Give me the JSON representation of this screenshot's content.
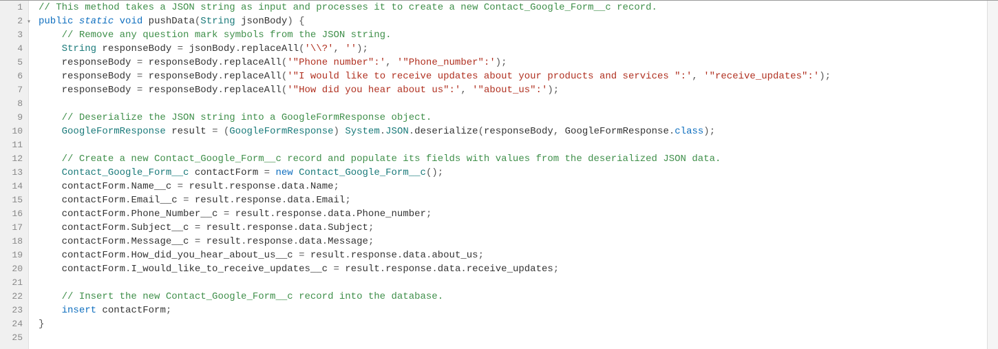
{
  "code": {
    "lines": [
      {
        "n": "1",
        "fold": false,
        "tokens": [
          {
            "c": "tok-comment",
            "t": "// This method takes a JSON string as input and processes it to create a new Contact_Google_Form__c record."
          }
        ]
      },
      {
        "n": "2",
        "fold": true,
        "tokens": [
          {
            "c": "tok-keyword",
            "t": "public"
          },
          {
            "c": "",
            "t": " "
          },
          {
            "c": "tok-static",
            "t": "static"
          },
          {
            "c": "",
            "t": " "
          },
          {
            "c": "tok-keyword",
            "t": "void"
          },
          {
            "c": "",
            "t": " "
          },
          {
            "c": "tok-method",
            "t": "pushData"
          },
          {
            "c": "tok-punc",
            "t": "("
          },
          {
            "c": "tok-type",
            "t": "String"
          },
          {
            "c": "",
            "t": " jsonBody"
          },
          {
            "c": "tok-punc",
            "t": ")"
          },
          {
            "c": "",
            "t": " "
          },
          {
            "c": "tok-punc",
            "t": "{"
          }
        ]
      },
      {
        "n": "3",
        "fold": false,
        "indent": 2,
        "tokens": [
          {
            "c": "tok-comment",
            "t": "// Remove any question mark symbols from the JSON string."
          }
        ]
      },
      {
        "n": "4",
        "fold": false,
        "indent": 2,
        "tokens": [
          {
            "c": "tok-type",
            "t": "String"
          },
          {
            "c": "",
            "t": " responseBody "
          },
          {
            "c": "tok-punc",
            "t": "="
          },
          {
            "c": "",
            "t": " jsonBody"
          },
          {
            "c": "tok-punc",
            "t": "."
          },
          {
            "c": "",
            "t": "replaceAll"
          },
          {
            "c": "tok-punc",
            "t": "("
          },
          {
            "c": "tok-string",
            "t": "'\\\\?'"
          },
          {
            "c": "tok-punc",
            "t": ","
          },
          {
            "c": "",
            "t": " "
          },
          {
            "c": "tok-string",
            "t": "''"
          },
          {
            "c": "tok-punc",
            "t": ");"
          }
        ]
      },
      {
        "n": "5",
        "fold": false,
        "indent": 2,
        "tokens": [
          {
            "c": "",
            "t": "responseBody "
          },
          {
            "c": "tok-punc",
            "t": "="
          },
          {
            "c": "",
            "t": " responseBody"
          },
          {
            "c": "tok-punc",
            "t": "."
          },
          {
            "c": "",
            "t": "replaceAll"
          },
          {
            "c": "tok-punc",
            "t": "("
          },
          {
            "c": "tok-string",
            "t": "'\"Phone number\":'"
          },
          {
            "c": "tok-punc",
            "t": ","
          },
          {
            "c": "",
            "t": " "
          },
          {
            "c": "tok-string",
            "t": "'\"Phone_number\":'"
          },
          {
            "c": "tok-punc",
            "t": ");"
          }
        ]
      },
      {
        "n": "6",
        "fold": false,
        "indent": 2,
        "tokens": [
          {
            "c": "",
            "t": "responseBody "
          },
          {
            "c": "tok-punc",
            "t": "="
          },
          {
            "c": "",
            "t": " responseBody"
          },
          {
            "c": "tok-punc",
            "t": "."
          },
          {
            "c": "",
            "t": "replaceAll"
          },
          {
            "c": "tok-punc",
            "t": "("
          },
          {
            "c": "tok-string",
            "t": "'\"I would like to receive updates about your products and services \":'"
          },
          {
            "c": "tok-punc",
            "t": ","
          },
          {
            "c": "",
            "t": " "
          },
          {
            "c": "tok-string",
            "t": "'\"receive_updates\":'"
          },
          {
            "c": "tok-punc",
            "t": ");"
          }
        ]
      },
      {
        "n": "7",
        "fold": false,
        "indent": 2,
        "tokens": [
          {
            "c": "",
            "t": "responseBody "
          },
          {
            "c": "tok-punc",
            "t": "="
          },
          {
            "c": "",
            "t": " responseBody"
          },
          {
            "c": "tok-punc",
            "t": "."
          },
          {
            "c": "",
            "t": "replaceAll"
          },
          {
            "c": "tok-punc",
            "t": "("
          },
          {
            "c": "tok-string",
            "t": "'\"How did you hear about us\":'"
          },
          {
            "c": "tok-punc",
            "t": ","
          },
          {
            "c": "",
            "t": " "
          },
          {
            "c": "tok-string",
            "t": "'\"about_us\":'"
          },
          {
            "c": "tok-punc",
            "t": ");"
          }
        ]
      },
      {
        "n": "8",
        "fold": false,
        "indent": 0,
        "tokens": []
      },
      {
        "n": "9",
        "fold": false,
        "indent": 2,
        "tokens": [
          {
            "c": "tok-comment",
            "t": "// Deserialize the JSON string into a GoogleFormResponse object."
          }
        ]
      },
      {
        "n": "10",
        "fold": false,
        "indent": 2,
        "tokens": [
          {
            "c": "tok-type",
            "t": "GoogleFormResponse"
          },
          {
            "c": "",
            "t": " result "
          },
          {
            "c": "tok-punc",
            "t": "="
          },
          {
            "c": "",
            "t": " "
          },
          {
            "c": "tok-punc",
            "t": "("
          },
          {
            "c": "tok-type",
            "t": "GoogleFormResponse"
          },
          {
            "c": "tok-punc",
            "t": ")"
          },
          {
            "c": "",
            "t": " "
          },
          {
            "c": "tok-class",
            "t": "System"
          },
          {
            "c": "tok-punc",
            "t": "."
          },
          {
            "c": "tok-class",
            "t": "JSON"
          },
          {
            "c": "tok-punc",
            "t": "."
          },
          {
            "c": "",
            "t": "deserialize"
          },
          {
            "c": "tok-punc",
            "t": "("
          },
          {
            "c": "",
            "t": "responseBody"
          },
          {
            "c": "tok-punc",
            "t": ","
          },
          {
            "c": "",
            "t": " GoogleFormResponse"
          },
          {
            "c": "tok-punc",
            "t": "."
          },
          {
            "c": "tok-keyword",
            "t": "class"
          },
          {
            "c": "tok-punc",
            "t": ");"
          }
        ]
      },
      {
        "n": "11",
        "fold": false,
        "indent": 0,
        "tokens": []
      },
      {
        "n": "12",
        "fold": false,
        "indent": 2,
        "tokens": [
          {
            "c": "tok-comment",
            "t": "// Create a new Contact_Google_Form__c record and populate its fields with values from the deserialized JSON data."
          }
        ]
      },
      {
        "n": "13",
        "fold": false,
        "indent": 2,
        "tokens": [
          {
            "c": "tok-type",
            "t": "Contact_Google_Form__c"
          },
          {
            "c": "",
            "t": " contactForm "
          },
          {
            "c": "tok-punc",
            "t": "="
          },
          {
            "c": "",
            "t": " "
          },
          {
            "c": "tok-keyword",
            "t": "new"
          },
          {
            "c": "",
            "t": " "
          },
          {
            "c": "tok-type",
            "t": "Contact_Google_Form__c"
          },
          {
            "c": "tok-punc",
            "t": "();"
          }
        ]
      },
      {
        "n": "14",
        "fold": false,
        "indent": 2,
        "tokens": [
          {
            "c": "",
            "t": "contactForm"
          },
          {
            "c": "tok-punc",
            "t": "."
          },
          {
            "c": "",
            "t": "Name__c "
          },
          {
            "c": "tok-punc",
            "t": "="
          },
          {
            "c": "",
            "t": " result"
          },
          {
            "c": "tok-punc",
            "t": "."
          },
          {
            "c": "",
            "t": "response"
          },
          {
            "c": "tok-punc",
            "t": "."
          },
          {
            "c": "",
            "t": "data"
          },
          {
            "c": "tok-punc",
            "t": "."
          },
          {
            "c": "",
            "t": "Name"
          },
          {
            "c": "tok-punc",
            "t": ";"
          }
        ]
      },
      {
        "n": "15",
        "fold": false,
        "indent": 2,
        "tokens": [
          {
            "c": "",
            "t": "contactForm"
          },
          {
            "c": "tok-punc",
            "t": "."
          },
          {
            "c": "",
            "t": "Email__c "
          },
          {
            "c": "tok-punc",
            "t": "="
          },
          {
            "c": "",
            "t": " result"
          },
          {
            "c": "tok-punc",
            "t": "."
          },
          {
            "c": "",
            "t": "response"
          },
          {
            "c": "tok-punc",
            "t": "."
          },
          {
            "c": "",
            "t": "data"
          },
          {
            "c": "tok-punc",
            "t": "."
          },
          {
            "c": "",
            "t": "Email"
          },
          {
            "c": "tok-punc",
            "t": ";"
          }
        ]
      },
      {
        "n": "16",
        "fold": false,
        "indent": 2,
        "tokens": [
          {
            "c": "",
            "t": "contactForm"
          },
          {
            "c": "tok-punc",
            "t": "."
          },
          {
            "c": "",
            "t": "Phone_Number__c "
          },
          {
            "c": "tok-punc",
            "t": "="
          },
          {
            "c": "",
            "t": " result"
          },
          {
            "c": "tok-punc",
            "t": "."
          },
          {
            "c": "",
            "t": "response"
          },
          {
            "c": "tok-punc",
            "t": "."
          },
          {
            "c": "",
            "t": "data"
          },
          {
            "c": "tok-punc",
            "t": "."
          },
          {
            "c": "",
            "t": "Phone_number"
          },
          {
            "c": "tok-punc",
            "t": ";"
          }
        ]
      },
      {
        "n": "17",
        "fold": false,
        "indent": 2,
        "tokens": [
          {
            "c": "",
            "t": "contactForm"
          },
          {
            "c": "tok-punc",
            "t": "."
          },
          {
            "c": "",
            "t": "Subject__c "
          },
          {
            "c": "tok-punc",
            "t": "="
          },
          {
            "c": "",
            "t": " result"
          },
          {
            "c": "tok-punc",
            "t": "."
          },
          {
            "c": "",
            "t": "response"
          },
          {
            "c": "tok-punc",
            "t": "."
          },
          {
            "c": "",
            "t": "data"
          },
          {
            "c": "tok-punc",
            "t": "."
          },
          {
            "c": "",
            "t": "Subject"
          },
          {
            "c": "tok-punc",
            "t": ";"
          }
        ]
      },
      {
        "n": "18",
        "fold": false,
        "indent": 2,
        "tokens": [
          {
            "c": "",
            "t": "contactForm"
          },
          {
            "c": "tok-punc",
            "t": "."
          },
          {
            "c": "",
            "t": "Message__c "
          },
          {
            "c": "tok-punc",
            "t": "="
          },
          {
            "c": "",
            "t": " result"
          },
          {
            "c": "tok-punc",
            "t": "."
          },
          {
            "c": "",
            "t": "response"
          },
          {
            "c": "tok-punc",
            "t": "."
          },
          {
            "c": "",
            "t": "data"
          },
          {
            "c": "tok-punc",
            "t": "."
          },
          {
            "c": "",
            "t": "Message"
          },
          {
            "c": "tok-punc",
            "t": ";"
          }
        ]
      },
      {
        "n": "19",
        "fold": false,
        "indent": 2,
        "tokens": [
          {
            "c": "",
            "t": "contactForm"
          },
          {
            "c": "tok-punc",
            "t": "."
          },
          {
            "c": "",
            "t": "How_did_you_hear_about_us__c "
          },
          {
            "c": "tok-punc",
            "t": "="
          },
          {
            "c": "",
            "t": " result"
          },
          {
            "c": "tok-punc",
            "t": "."
          },
          {
            "c": "",
            "t": "response"
          },
          {
            "c": "tok-punc",
            "t": "."
          },
          {
            "c": "",
            "t": "data"
          },
          {
            "c": "tok-punc",
            "t": "."
          },
          {
            "c": "",
            "t": "about_us"
          },
          {
            "c": "tok-punc",
            "t": ";"
          }
        ]
      },
      {
        "n": "20",
        "fold": false,
        "indent": 2,
        "tokens": [
          {
            "c": "",
            "t": "contactForm"
          },
          {
            "c": "tok-punc",
            "t": "."
          },
          {
            "c": "",
            "t": "I_would_like_to_receive_updates__c "
          },
          {
            "c": "tok-punc",
            "t": "="
          },
          {
            "c": "",
            "t": " result"
          },
          {
            "c": "tok-punc",
            "t": "."
          },
          {
            "c": "",
            "t": "response"
          },
          {
            "c": "tok-punc",
            "t": "."
          },
          {
            "c": "",
            "t": "data"
          },
          {
            "c": "tok-punc",
            "t": "."
          },
          {
            "c": "",
            "t": "receive_updates"
          },
          {
            "c": "tok-punc",
            "t": ";"
          }
        ]
      },
      {
        "n": "21",
        "fold": false,
        "indent": 0,
        "tokens": []
      },
      {
        "n": "22",
        "fold": false,
        "indent": 2,
        "tokens": [
          {
            "c": "tok-comment",
            "t": "// Insert the new Contact_Google_Form__c record into the database."
          }
        ]
      },
      {
        "n": "23",
        "fold": false,
        "indent": 2,
        "tokens": [
          {
            "c": "tok-keyword",
            "t": "insert"
          },
          {
            "c": "",
            "t": " contactForm"
          },
          {
            "c": "tok-punc",
            "t": ";"
          }
        ]
      },
      {
        "n": "24",
        "fold": false,
        "indent": 0,
        "tokens": [
          {
            "c": "tok-punc",
            "t": "}"
          }
        ]
      },
      {
        "n": "25",
        "fold": false,
        "indent": 0,
        "tokens": []
      }
    ]
  }
}
